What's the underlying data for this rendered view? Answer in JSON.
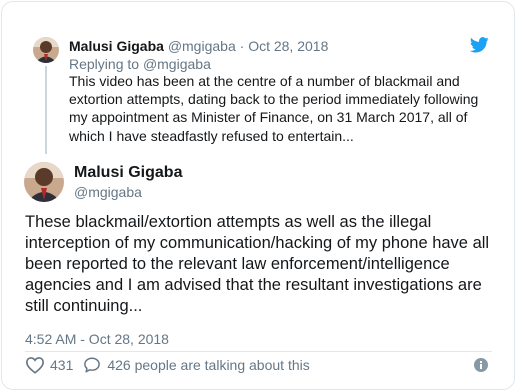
{
  "parent_tweet": {
    "author_name": "Malusi Gigaba",
    "author_handle": "@mgigaba",
    "separator": "·",
    "date": "Oct 28, 2018",
    "replying_to_label": "Replying to",
    "replying_to_handle": "@mgigaba",
    "lines": [
      "This video has been at the centre of a number of blackmail and",
      "extortion attempts, dating back to the period immediately following",
      "my appointment as Minister of Finance, on 31 March 2017, all of",
      "which I have steadfastly refused to entertain..."
    ]
  },
  "main_tweet": {
    "author_name": "Malusi Gigaba",
    "author_handle": "@mgigaba",
    "lines": [
      "These blackmail/extortion attempts as well as the illegal",
      "interception of my communication/hacking of my phone have all",
      "been reported to the relevant law enforcement/intelligence",
      "agencies and I am advised that the resultant investigations are",
      "still continuing..."
    ],
    "timestamp": "4:52 AM - Oct 28, 2018",
    "like_count": "431",
    "talking_text": "426 people are talking about this"
  },
  "icons": {
    "brand": "twitter-bird-icon",
    "like": "heart-icon",
    "talk": "speech-bubble-icon",
    "info": "info-icon"
  },
  "colors": {
    "twitter_blue": "#1da1f2",
    "text": "#14171a",
    "secondary": "#657786",
    "border": "#e1e8ed"
  }
}
